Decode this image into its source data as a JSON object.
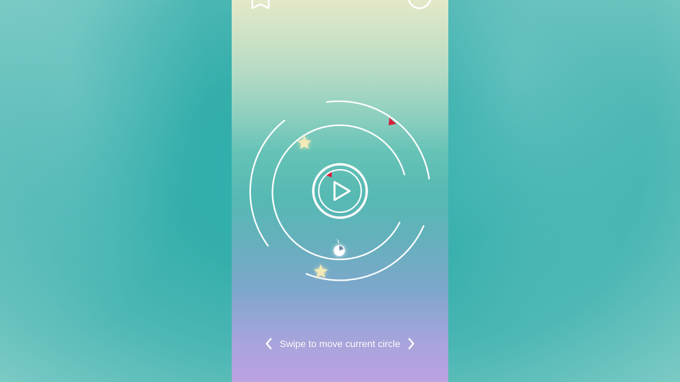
{
  "colors": {
    "ring": "#ffffff",
    "marker": "#d81e3a",
    "star": "#f4eab8",
    "hint_text": "#ffffff"
  },
  "icons": {
    "top_left": "ribbon-icon",
    "top_right": "circle-icon",
    "play": "play-icon",
    "left": "chevron-left-icon",
    "right": "chevron-right-icon"
  },
  "hint": {
    "text": "Swipe to move current circle"
  }
}
